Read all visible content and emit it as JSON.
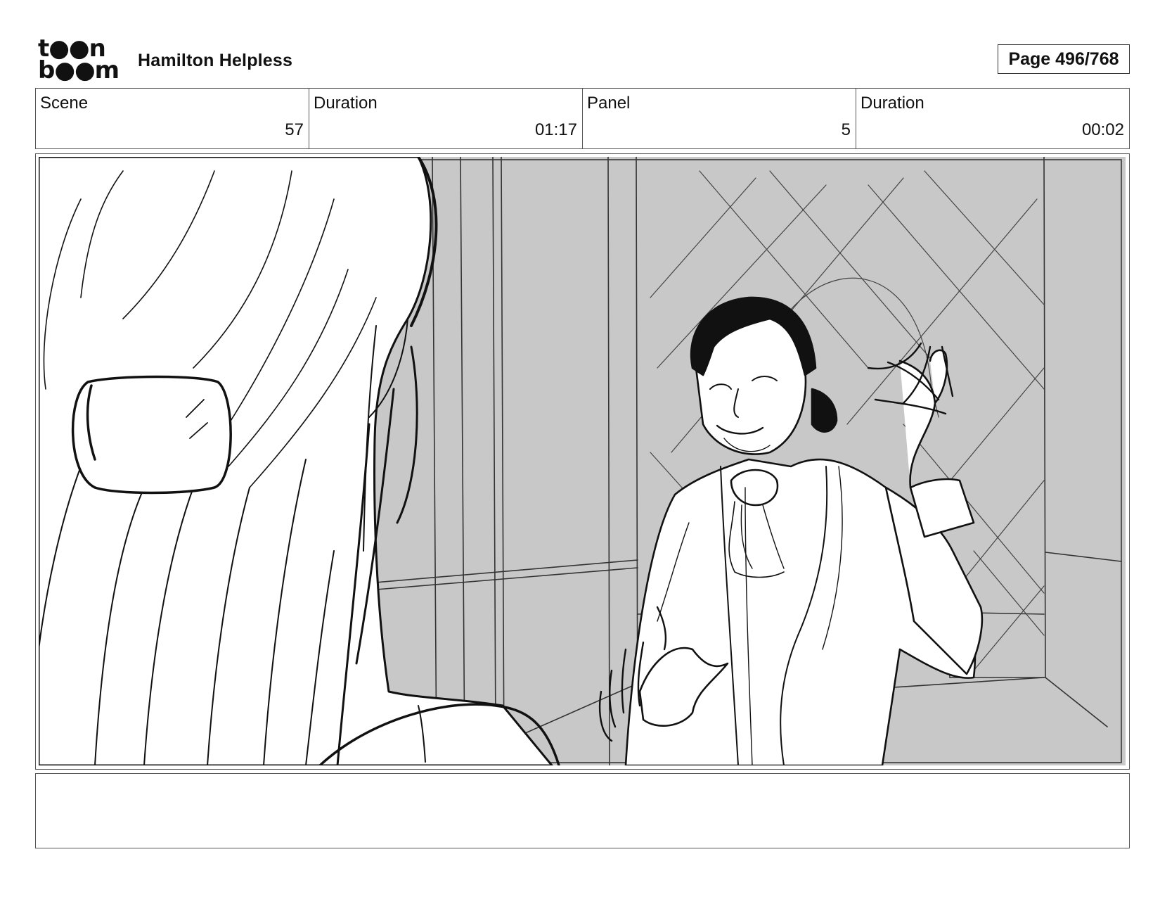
{
  "header": {
    "logo_line1": "t●●n",
    "logo_line2": "b●●m",
    "project_title": "Hamilton Helpless",
    "page_indicator": "Page 496/768"
  },
  "info": [
    {
      "label": "Scene",
      "value": "57"
    },
    {
      "label": "Duration",
      "value": "01:17"
    },
    {
      "label": "Panel",
      "value": "5"
    },
    {
      "label": "Duration",
      "value": "00:02"
    }
  ],
  "panel": {
    "background_color": "#c8c8c8",
    "line_color": "#111111"
  },
  "notes": {
    "text": ""
  }
}
